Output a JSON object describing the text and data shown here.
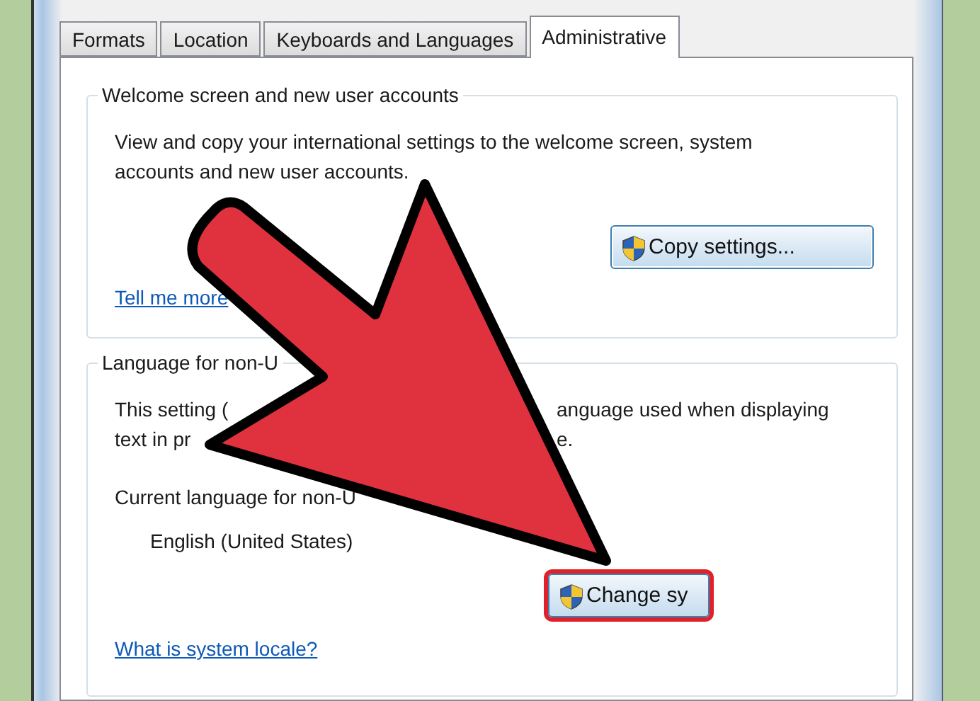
{
  "tabs": [
    {
      "label": "Formats",
      "selected": false
    },
    {
      "label": "Location",
      "selected": false
    },
    {
      "label": "Keyboards and Languages",
      "selected": false
    },
    {
      "label": "Administrative",
      "selected": true
    }
  ],
  "welcome_group": {
    "title": "Welcome screen and new user accounts",
    "lines": [
      [
        "View and copy your international settings to the welcome screen, system"
      ],
      [
        "accounts and new user accounts."
      ]
    ],
    "button": {
      "label": "Copy settings...",
      "highlighted": false
    },
    "link": "Tell me more"
  },
  "locale_group": {
    "title": "Language for non-U",
    "lines": [
      [
        "This setting (",
        "anguage used when displaying"
      ],
      [
        "text in pr",
        "e."
      ]
    ],
    "label": "Current language for non-U",
    "value": "English (United States)",
    "button": {
      "label": "Change sy",
      "highlighted": true
    },
    "link": "What is system locale?"
  }
}
